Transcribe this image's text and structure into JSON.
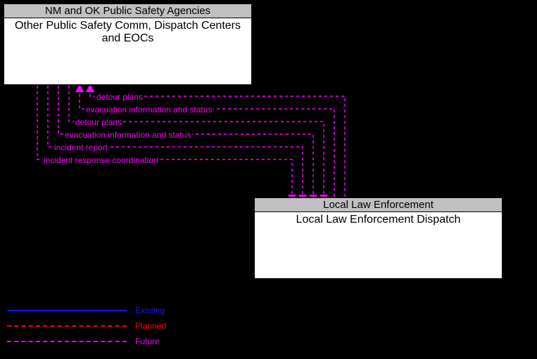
{
  "boxes": {
    "top": {
      "header": "NM and OK Public Safety Agencies",
      "body": "Other Public Safety Comm, Dispatch Centers and EOCs"
    },
    "bottom": {
      "header": "Local Law Enforcement",
      "body": "Local Law Enforcement Dispatch"
    }
  },
  "flows": [
    {
      "label": "detour plans",
      "direction": "up"
    },
    {
      "label": "evacuation information and status",
      "direction": "up"
    },
    {
      "label": "detour plans",
      "direction": "down"
    },
    {
      "label": "evacuation information and status",
      "direction": "down"
    },
    {
      "label": "incident report",
      "direction": "down"
    },
    {
      "label": "incident response coordination",
      "direction": "down"
    }
  ],
  "legend": {
    "existing": "Existing",
    "planned": "Planned",
    "future": "Future"
  },
  "style": {
    "future_color": "#ff00ff",
    "planned_color": "#ff0000",
    "existing_color": "#1818ff"
  }
}
